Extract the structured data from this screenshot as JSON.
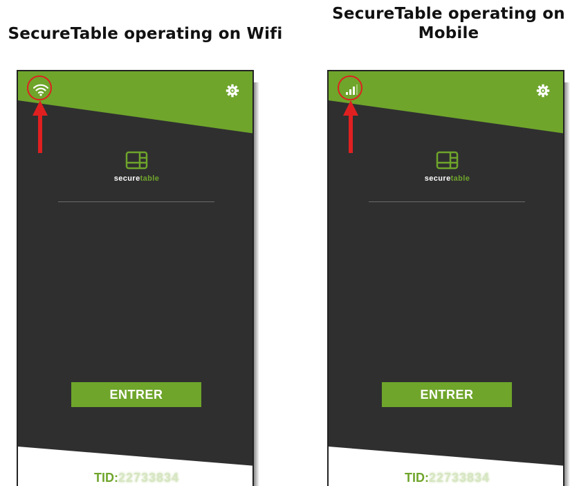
{
  "panels": [
    {
      "title": "SecureTable operating on Wifi",
      "status_icon": "wifi-icon",
      "logo_text_a": "secure",
      "logo_text_b": "table",
      "enter_label": "ENTRER",
      "tid_label": "TID:",
      "tid_value": "22733834"
    },
    {
      "title": "SecureTable operating on Mobile",
      "status_icon": "mobile-signal-icon",
      "logo_text_a": "secure",
      "logo_text_b": "table",
      "enter_label": "ENTRER",
      "tid_label": "TID:",
      "tid_value": "22733834"
    }
  ],
  "colors": {
    "brand_green": "#6fa52b",
    "screen_dark": "#2f2f30",
    "annotation_red": "#e02020"
  }
}
